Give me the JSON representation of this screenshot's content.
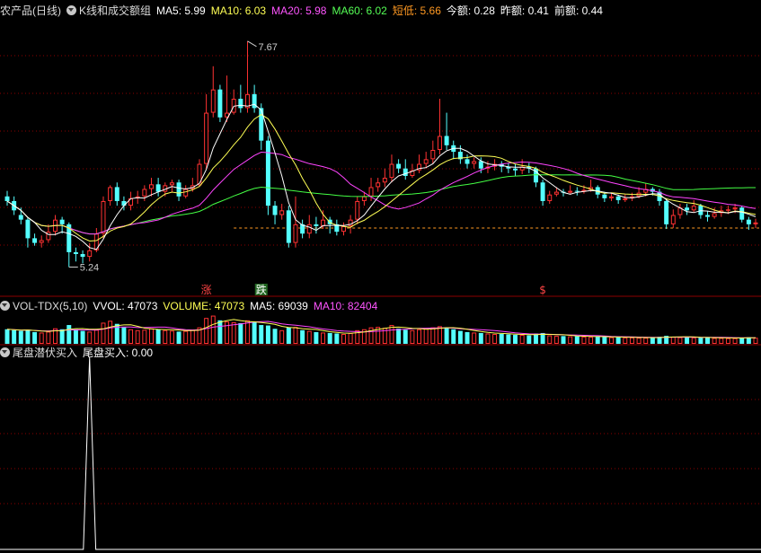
{
  "main_header": {
    "title": "农产品(日线)",
    "indicator": "K线和成交额组",
    "items": [
      {
        "text": "MA5: 5.99",
        "color": "#ffffff"
      },
      {
        "text": "MA10: 6.03",
        "color": "#ffff55"
      },
      {
        "text": "MA20: 5.98",
        "color": "#ff55ff"
      },
      {
        "text": "MA60: 6.02",
        "color": "#55ff55"
      },
      {
        "text": "短低: 5.66",
        "color": "#ff9922"
      },
      {
        "text": "今额: 0.28",
        "color": "#ffffff"
      },
      {
        "text": "昨额: 0.41",
        "color": "#ffffff"
      },
      {
        "text": "前额: 0.44",
        "color": "#ffffff"
      }
    ]
  },
  "vol_header": {
    "title": "VOL-TDX(5,10)",
    "items": [
      {
        "text": "VVOL: 47073",
        "color": "#ffffff"
      },
      {
        "text": "VOLUME: 47073",
        "color": "#ffff55"
      },
      {
        "text": "MA5: 69039",
        "color": "#ffffff"
      },
      {
        "text": "MA10: 82404",
        "color": "#ff55ff"
      }
    ]
  },
  "signal_header": {
    "title": "尾盘潜伏买入",
    "items": [
      {
        "text": "尾盘买入: 0.00",
        "color": "#ffffff"
      }
    ]
  },
  "colors": {
    "up": "#ff3232",
    "down": "#54ffff",
    "ma5": "#ffffff",
    "ma10": "#ffff55",
    "ma20": "#ff44ff",
    "ma60": "#44ff44",
    "grid": "#8b0000",
    "short_low": "#ff9922"
  },
  "annotations": {
    "high_label": "7.67",
    "low_label": "5.24",
    "rise": "涨",
    "fall": "跌",
    "dollar": "$"
  },
  "chart_data": {
    "type": "candlestick",
    "short_low": 5.66,
    "candles": [
      [
        6.0,
        5.95,
        6.06,
        5.9
      ],
      [
        5.95,
        5.85,
        6.0,
        5.8
      ],
      [
        5.8,
        5.75,
        5.88,
        5.7
      ],
      [
        5.75,
        5.55,
        5.78,
        5.45
      ],
      [
        5.55,
        5.5,
        5.6,
        5.47
      ],
      [
        5.5,
        5.53,
        5.58,
        5.45
      ],
      [
        5.53,
        5.62,
        5.7,
        5.5
      ],
      [
        5.62,
        5.75,
        5.8,
        5.58
      ],
      [
        5.75,
        5.7,
        5.78,
        5.6
      ],
      [
        5.7,
        5.4,
        5.72,
        5.24
      ],
      [
        5.4,
        5.38,
        5.45,
        5.3
      ],
      [
        5.38,
        5.35,
        5.42,
        5.28
      ],
      [
        5.35,
        5.42,
        5.5,
        5.3
      ],
      [
        5.42,
        5.6,
        5.66,
        5.4
      ],
      [
        5.6,
        5.95,
        6.0,
        5.55
      ],
      [
        5.95,
        6.1,
        6.12,
        5.9
      ],
      [
        6.1,
        5.95,
        6.15,
        5.9
      ],
      [
        5.95,
        5.9,
        6.0,
        5.85
      ],
      [
        5.9,
        5.98,
        6.05,
        5.85
      ],
      [
        5.98,
        6.0,
        6.06,
        5.92
      ],
      [
        6.0,
        6.08,
        6.12,
        5.95
      ],
      [
        6.08,
        6.13,
        6.2,
        6.0
      ],
      [
        6.13,
        6.05,
        6.2,
        6.0
      ],
      [
        6.05,
        6.12,
        6.15,
        6.0
      ],
      [
        6.12,
        6.15,
        6.18,
        6.05
      ],
      [
        6.15,
        6.0,
        6.18,
        5.95
      ],
      [
        6.0,
        6.08,
        6.12,
        5.98
      ],
      [
        6.08,
        6.12,
        6.2,
        6.05
      ],
      [
        6.12,
        6.35,
        6.4,
        6.1
      ],
      [
        6.35,
        6.9,
        7.1,
        6.3
      ],
      [
        6.9,
        7.15,
        7.4,
        6.85
      ],
      [
        7.15,
        6.85,
        7.2,
        6.8
      ],
      [
        6.85,
        6.9,
        7.3,
        6.8
      ],
      [
        6.9,
        7.05,
        7.15,
        6.88
      ],
      [
        7.05,
        6.95,
        7.2,
        6.9
      ],
      [
        6.95,
        7.1,
        7.67,
        6.9
      ],
      [
        7.1,
        6.95,
        7.2,
        6.9
      ],
      [
        6.95,
        6.6,
        7.0,
        6.5
      ],
      [
        6.6,
        5.9,
        6.65,
        5.8
      ],
      [
        5.9,
        5.8,
        5.95,
        5.7
      ],
      [
        5.8,
        5.85,
        5.92,
        5.75
      ],
      [
        5.85,
        5.5,
        5.9,
        5.45
      ],
      [
        5.5,
        5.7,
        6.0,
        5.45
      ],
      [
        5.7,
        5.6,
        5.75,
        5.55
      ],
      [
        5.6,
        5.7,
        5.8,
        5.55
      ],
      [
        5.7,
        5.68,
        5.78,
        5.6
      ],
      [
        5.68,
        5.75,
        5.85,
        5.65
      ],
      [
        5.75,
        5.7,
        5.78,
        5.6
      ],
      [
        5.7,
        5.62,
        5.75,
        5.58
      ],
      [
        5.62,
        5.68,
        5.72,
        5.58
      ],
      [
        5.68,
        5.75,
        5.8,
        5.6
      ],
      [
        5.75,
        5.95,
        6.0,
        5.7
      ],
      [
        5.95,
        6.0,
        6.05,
        5.9
      ],
      [
        6.0,
        6.1,
        6.2,
        5.95
      ],
      [
        6.1,
        6.15,
        6.2,
        6.05
      ],
      [
        6.15,
        6.2,
        6.3,
        6.1
      ],
      [
        6.2,
        6.35,
        6.45,
        6.15
      ],
      [
        6.35,
        6.3,
        6.4,
        6.25
      ],
      [
        6.3,
        6.22,
        6.4,
        6.18
      ],
      [
        6.22,
        6.28,
        6.35,
        6.2
      ],
      [
        6.28,
        6.35,
        6.45,
        6.25
      ],
      [
        6.35,
        6.4,
        6.48,
        6.3
      ],
      [
        6.4,
        6.5,
        6.6,
        6.35
      ],
      [
        6.5,
        6.65,
        7.05,
        6.45
      ],
      [
        6.65,
        6.55,
        6.9,
        6.5
      ],
      [
        6.55,
        6.48,
        6.6,
        6.4
      ],
      [
        6.48,
        6.4,
        6.55,
        6.35
      ],
      [
        6.4,
        6.35,
        6.45,
        6.3
      ],
      [
        6.35,
        6.38,
        6.42,
        6.3
      ],
      [
        6.38,
        6.3,
        6.42,
        6.25
      ],
      [
        6.3,
        6.32,
        6.38,
        6.25
      ],
      [
        6.32,
        6.35,
        6.4,
        6.28
      ],
      [
        6.35,
        6.32,
        6.38,
        6.26
      ],
      [
        6.32,
        6.3,
        6.36,
        6.25
      ],
      [
        6.3,
        6.28,
        6.35,
        6.22
      ],
      [
        6.28,
        6.32,
        6.4,
        6.24
      ],
      [
        6.32,
        6.3,
        6.36,
        6.25
      ],
      [
        6.3,
        6.15,
        6.32,
        6.1
      ],
      [
        6.15,
        5.95,
        6.18,
        5.9
      ],
      [
        5.95,
        6.02,
        6.06,
        5.92
      ],
      [
        6.02,
        6.05,
        6.1,
        6.0
      ],
      [
        6.05,
        6.04,
        6.08,
        6.0
      ],
      [
        6.04,
        6.06,
        6.12,
        6.02
      ],
      [
        6.06,
        6.05,
        6.1,
        6.01
      ],
      [
        6.05,
        6.07,
        6.12,
        6.03
      ],
      [
        6.07,
        6.1,
        6.18,
        6.05
      ],
      [
        6.1,
        6.02,
        6.12,
        5.98
      ],
      [
        6.02,
        5.98,
        6.05,
        5.94
      ],
      [
        5.98,
        6.0,
        6.04,
        5.95
      ],
      [
        6.0,
        5.96,
        6.02,
        5.92
      ],
      [
        5.96,
        5.98,
        6.02,
        5.94
      ],
      [
        5.98,
        6.0,
        6.04,
        5.95
      ],
      [
        6.0,
        6.04,
        6.1,
        5.98
      ],
      [
        6.04,
        6.08,
        6.14,
        6.0
      ],
      [
        6.08,
        6.05,
        6.1,
        6.01
      ],
      [
        6.05,
        5.95,
        6.08,
        5.9
      ],
      [
        5.95,
        5.7,
        5.98,
        5.65
      ],
      [
        5.7,
        5.8,
        5.86,
        5.66
      ],
      [
        5.8,
        5.88,
        5.92,
        5.76
      ],
      [
        5.88,
        5.85,
        5.92,
        5.8
      ],
      [
        5.85,
        5.9,
        5.96,
        5.83
      ],
      [
        5.9,
        5.8,
        5.92,
        5.76
      ],
      [
        5.8,
        5.78,
        5.84,
        5.73
      ],
      [
        5.78,
        5.82,
        5.88,
        5.76
      ],
      [
        5.82,
        5.85,
        5.9,
        5.78
      ],
      [
        5.85,
        5.86,
        5.9,
        5.81
      ],
      [
        5.86,
        5.88,
        5.92,
        5.82
      ],
      [
        5.88,
        5.75,
        5.9,
        5.72
      ],
      [
        5.75,
        5.7,
        5.78,
        5.64
      ],
      [
        5.7,
        5.72,
        5.76,
        5.66
      ]
    ],
    "volume": [
      62,
      58,
      55,
      60,
      50,
      48,
      52,
      66,
      62,
      80,
      62,
      55,
      52,
      60,
      90,
      98,
      85,
      70,
      62,
      58,
      60,
      66,
      62,
      58,
      56,
      52,
      55,
      60,
      70,
      110,
      120,
      100,
      95,
      92,
      88,
      100,
      92,
      80,
      78,
      64,
      58,
      70,
      72,
      58,
      55,
      50,
      48,
      46,
      44,
      42,
      46,
      58,
      62,
      70,
      72,
      68,
      80,
      65,
      60,
      58,
      62,
      66,
      70,
      75,
      70,
      62,
      55,
      50,
      48,
      46,
      44,
      42,
      42,
      40,
      38,
      38,
      36,
      44,
      46,
      36,
      34,
      33,
      32,
      32,
      31,
      30,
      30,
      29,
      28,
      28,
      27,
      27,
      26,
      26,
      25,
      30,
      34,
      30,
      28,
      28,
      27,
      26,
      26,
      25,
      25,
      24,
      24,
      26,
      28,
      26
    ],
    "signal": {
      "values": [
        0,
        1,
        0
      ],
      "peak_index": 12
    }
  }
}
